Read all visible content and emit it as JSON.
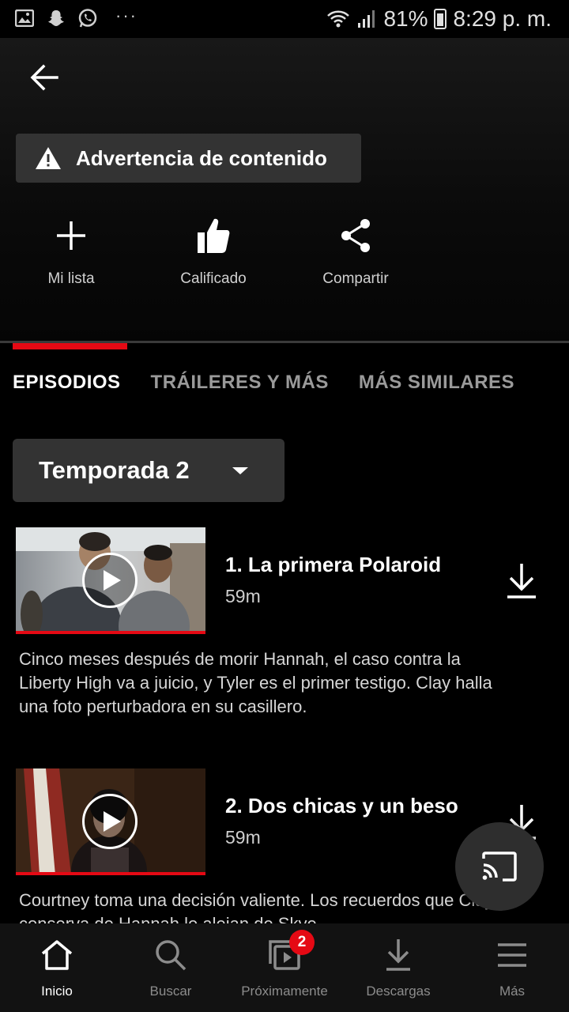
{
  "status_bar": {
    "battery": "81%",
    "time": "8:29 p. m.",
    "dots": "···",
    "left_icons": [
      "gallery-icon",
      "snapchat-icon",
      "whatsapp-icon"
    ],
    "right_icons": [
      "wifi-icon",
      "signal-icon",
      "battery-icon"
    ]
  },
  "header": {
    "back_icon": "arrow-left-icon",
    "content_warning": "Advertencia de contenido",
    "actions": [
      {
        "label": "Mi lista",
        "icon": "plus-icon"
      },
      {
        "label": "Calificado",
        "icon": "thumbs-up-icon"
      },
      {
        "label": "Compartir",
        "icon": "share-icon"
      }
    ]
  },
  "tabs": [
    {
      "label": "EPISODIOS",
      "active": true
    },
    {
      "label": "TRÁILERES Y MÁS",
      "active": false
    },
    {
      "label": "MÁS SIMILARES",
      "active": false
    }
  ],
  "season_selector": {
    "label": "Temporada 2"
  },
  "episodes": [
    {
      "title": "1. La primera Polaroid",
      "duration": "59m",
      "description": "Cinco meses después de morir Hannah, el caso contra la Liberty High va a juicio, y Tyler es el primer testigo. Clay halla una foto perturbadora en su casillero."
    },
    {
      "title": "2. Dos chicas y un beso",
      "duration": "59m",
      "description": "Courtney toma una decisión valiente. Los recuerdos que Clay conserva de Hannah lo alejan de Skye."
    }
  ],
  "bottom_nav": [
    {
      "label": "Inicio",
      "icon": "home-icon",
      "active": true
    },
    {
      "label": "Buscar",
      "icon": "search-icon",
      "active": false
    },
    {
      "label": "Próximamente",
      "icon": "coming-soon-icon",
      "active": false,
      "badge": "2"
    },
    {
      "label": "Descargas",
      "icon": "download-icon",
      "active": false
    },
    {
      "label": "Más",
      "icon": "menu-icon",
      "active": false
    }
  ],
  "colors": {
    "accent": "#e50914",
    "background": "#000000",
    "chip": "#333333"
  }
}
